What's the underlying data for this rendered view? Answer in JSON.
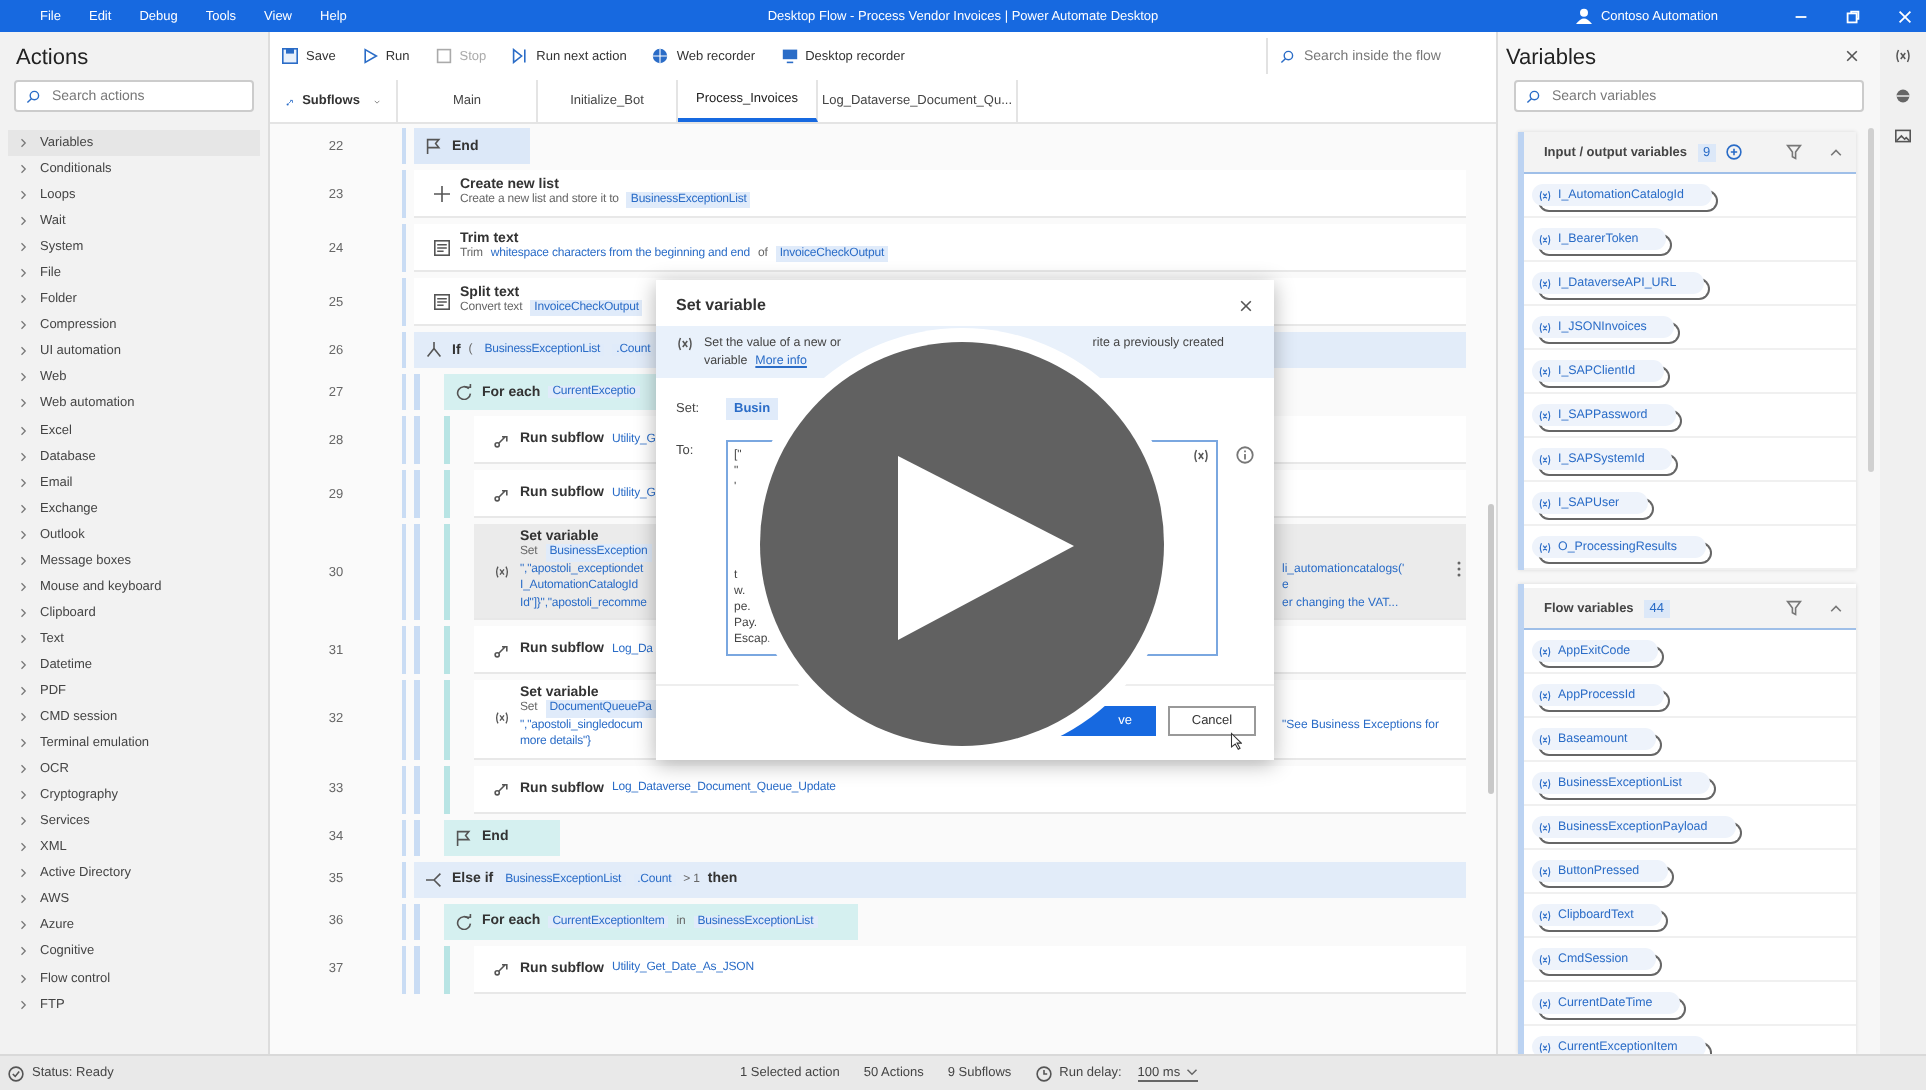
{
  "title_bar": {
    "menu": [
      "File",
      "Edit",
      "Debug",
      "Tools",
      "View",
      "Help"
    ],
    "title": "Desktop Flow - Process Vendor Invoices | Power Automate Desktop",
    "account": "Contoso Automation"
  },
  "actions_panel": {
    "title": "Actions",
    "search": {
      "placeholder": "Search actions"
    },
    "groups": [
      {
        "label": "Variables",
        "selected": true
      },
      {
        "label": "Conditionals",
        "selected": false
      },
      {
        "label": "Loops",
        "selected": false
      },
      {
        "label": "Wait",
        "selected": false
      },
      {
        "label": "System",
        "selected": false
      },
      {
        "label": "File",
        "selected": false
      },
      {
        "label": "Folder",
        "selected": false
      },
      {
        "label": "Compression",
        "selected": false
      },
      {
        "label": "UI automation",
        "selected": false
      },
      {
        "label": "Web",
        "selected": false
      },
      {
        "label": "Web automation",
        "selected": false
      },
      {
        "label": "Excel",
        "selected": false
      },
      {
        "label": "Database",
        "selected": false
      },
      {
        "label": "Email",
        "selected": false
      },
      {
        "label": "Exchange",
        "selected": false
      },
      {
        "label": "Outlook",
        "selected": false
      },
      {
        "label": "Message boxes",
        "selected": false
      },
      {
        "label": "Mouse and keyboard",
        "selected": false
      },
      {
        "label": "Clipboard",
        "selected": false
      },
      {
        "label": "Text",
        "selected": false
      },
      {
        "label": "Datetime",
        "selected": false
      },
      {
        "label": "PDF",
        "selected": false
      },
      {
        "label": "CMD session",
        "selected": false
      },
      {
        "label": "Terminal emulation",
        "selected": false
      },
      {
        "label": "OCR",
        "selected": false
      },
      {
        "label": "Cryptography",
        "selected": false
      },
      {
        "label": "Services",
        "selected": false
      },
      {
        "label": "XML",
        "selected": false
      },
      {
        "label": "Active Directory",
        "selected": false
      },
      {
        "label": "AWS",
        "selected": false
      },
      {
        "label": "Azure",
        "selected": false
      },
      {
        "label": "Cognitive",
        "selected": false
      },
      {
        "label": "Flow control",
        "selected": false
      },
      {
        "label": "FTP",
        "selected": false
      }
    ]
  },
  "toolbar": {
    "buttons": [
      {
        "label": "Save",
        "disabled": false
      },
      {
        "label": "Run",
        "disabled": false
      },
      {
        "label": "Stop",
        "disabled": true
      },
      {
        "label": "Run next action",
        "disabled": false
      },
      {
        "label": "Web recorder",
        "disabled": false
      },
      {
        "label": "Desktop recorder",
        "disabled": false
      }
    ],
    "search": {
      "placeholder": "Search inside the flow"
    }
  },
  "tabs": {
    "subflows": "Subflows",
    "items": [
      {
        "label": "Main",
        "selected": false
      },
      {
        "label": "Initialize_Bot",
        "selected": false
      },
      {
        "label": "Process_Invoices",
        "selected": true
      },
      {
        "label": "Log_Dataverse_Document_Qu...",
        "selected": false
      }
    ]
  },
  "flow": {
    "steps": [
      {
        "line": "22",
        "kind": "end_if",
        "title": "End",
        "selected": false
      },
      {
        "line": "23",
        "kind": "create_list",
        "title": "Create new list",
        "selected": false,
        "lines": [
          {
            "parts": [
              {
                "kind": "text",
                "text": "Create a new list and store it to"
              },
              {
                "kind": "var",
                "text": "BusinessExceptionList"
              }
            ]
          }
        ]
      },
      {
        "line": "24",
        "kind": "text_action",
        "title": "Trim text",
        "selected": false,
        "lines": [
          {
            "parts": [
              {
                "kind": "text",
                "text": "Trim"
              },
              {
                "kind": "value",
                "text": "whitespace characters from the beginning and end"
              },
              {
                "kind": "text",
                "text": "of"
              },
              {
                "kind": "var",
                "text": "InvoiceCheckOutput"
              }
            ]
          }
        ]
      },
      {
        "line": "25",
        "kind": "text_action",
        "title": "Split text",
        "selected": false,
        "lines": [
          {
            "parts": [
              {
                "kind": "text",
                "text": "Convert text"
              },
              {
                "kind": "var",
                "text": "InvoiceCheckOutput"
              }
            ]
          }
        ]
      },
      {
        "line": "26",
        "kind": "if",
        "title": "If",
        "selected": false,
        "parts": [
          {
            "kind": "text",
            "text": "("
          },
          {
            "kind": "var",
            "text": "BusinessExceptionList"
          },
          {
            "kind": "var",
            "text": ".Count"
          }
        ],
        "children": [
          {
            "line": "27",
            "kind": "for_each",
            "title": "For each",
            "selected": false,
            "parts": [
              {
                "kind": "var",
                "text": "CurrentExceptio"
              }
            ],
            "children": [
              {
                "line": "28",
                "kind": "run_subflow",
                "title": "Run subflow",
                "selected": false,
                "parts": [
                  {
                    "kind": "value",
                    "text": "Utility_G"
                  }
                ]
              },
              {
                "line": "29",
                "kind": "run_subflow",
                "title": "Run subflow",
                "selected": false,
                "parts": [
                  {
                    "kind": "value",
                    "text": "Utility_G"
                  }
                ]
              },
              {
                "line": "30",
                "kind": "set_variable",
                "title": "Set variable",
                "selected": true,
                "lines": [
                  {
                    "parts": [
                      {
                        "kind": "text",
                        "text": "Set"
                      },
                      {
                        "kind": "var",
                        "text": "BusinessException"
                      }
                    ]
                  },
                  {
                    "parts": [
                      {
                        "kind": "value",
                        "text": "\",\"apostoli_exceptiondet"
                      }
                    ],
                    "tail": "li_automationcatalogs('"
                  },
                  {
                    "parts": [
                      {
                        "kind": "value",
                        "text": "I_AutomationCatalogId"
                      }
                    ],
                    "tail": "e"
                  },
                  {
                    "parts": [
                      {
                        "kind": "value",
                        "text": "Id\"]}\",\"apostoli_recomme"
                      }
                    ],
                    "tail": "er changing the VAT..."
                  }
                ]
              },
              {
                "line": "31",
                "kind": "run_subflow",
                "title": "Run subflow",
                "selected": false,
                "parts": [
                  {
                    "kind": "value",
                    "text": "Log_Da"
                  }
                ]
              },
              {
                "line": "32",
                "kind": "set_variable",
                "title": "Set variable",
                "selected": false,
                "lines": [
                  {
                    "parts": [
                      {
                        "kind": "text",
                        "text": "Set"
                      },
                      {
                        "kind": "var",
                        "text": "DocumentQueuePa"
                      }
                    ]
                  },
                  {
                    "parts": [
                      {
                        "kind": "value",
                        "text": "\",\"apostoli_singledocum"
                      }
                    ],
                    "tail": "\"See Business Exceptions for"
                  },
                  {
                    "parts": [
                      {
                        "kind": "value",
                        "text": "more details\"}"
                      }
                    ]
                  }
                ]
              },
              {
                "line": "33",
                "kind": "run_subflow",
                "title": "Run subflow",
                "selected": false,
                "parts": [
                  {
                    "kind": "value",
                    "text": "Log_Dataverse_Document_Queue_Update"
                  }
                ]
              }
            ]
          },
          {
            "line": "34",
            "kind": "end_loop",
            "title": "End",
            "selected": false
          }
        ]
      },
      {
        "line": "35",
        "kind": "else_if",
        "title": "Else if",
        "selected": false,
        "parts": [
          {
            "kind": "var",
            "text": "BusinessExceptionList"
          },
          {
            "kind": "var",
            "text": ".Count"
          },
          {
            "kind": "text",
            "text": "> 1"
          },
          {
            "kind": "keyword",
            "text": "then"
          }
        ],
        "children": [
          {
            "line": "36",
            "kind": "for_each",
            "title": "For each",
            "selected": false,
            "parts": [
              {
                "kind": "var",
                "text": "CurrentExceptionItem"
              },
              {
                "kind": "text",
                "text": "in"
              },
              {
                "kind": "var",
                "text": "BusinessExceptionList"
              }
            ],
            "children": [
              {
                "line": "37",
                "kind": "run_subflow",
                "title": "Run subflow",
                "selected": false,
                "parts": [
                  {
                    "kind": "value",
                    "text": "Utility_Get_Date_As_JSON"
                  }
                ]
              }
            ]
          }
        ]
      }
    ]
  },
  "dialog": {
    "title": "Set variable",
    "info_left": "Set the value of a new or",
    "info_right": "rite a previously created",
    "info_line2": "variable",
    "info_link": "More info",
    "set_label": "Set:",
    "set_value": "Busin",
    "to_label": "To:",
    "to_lines_top": [
      "[\"",
      "\"",
      "'"
    ],
    "to_lines_bottom": [
      "t",
      "w.",
      "pe.",
      "Pay.",
      "Escap."
    ],
    "save": "ve",
    "cancel": "Cancel"
  },
  "variables_panel": {
    "title": "Variables",
    "search": {
      "placeholder": "Search variables"
    },
    "sections": [
      {
        "kind": "io",
        "title": "Input / output variables",
        "count": "9",
        "items": [
          "I_AutomationCatalogId",
          "I_BearerToken",
          "I_DataverseAPI_URL",
          "I_JSONInvoices",
          "I_SAPClientId",
          "I_SAPPassword",
          "I_SAPSystemId",
          "I_SAPUser",
          "O_ProcessingResults"
        ]
      },
      {
        "kind": "flow",
        "title": "Flow variables",
        "count": "44",
        "items": [
          "AppExitCode",
          "AppProcessId",
          "Baseamount",
          "BusinessExceptionList",
          "BusinessExceptionPayload",
          "ButtonPressed",
          "ClipboardText",
          "CmdSession",
          "CurrentDateTime",
          "CurrentExceptionItem"
        ]
      }
    ]
  },
  "status_bar": {
    "status": "Status: Ready",
    "selection": "1 Selected action",
    "actions": "50 Actions",
    "subflows": "9 Subflows",
    "run_delay_label": "Run delay:",
    "run_delay": "100 ms"
  }
}
